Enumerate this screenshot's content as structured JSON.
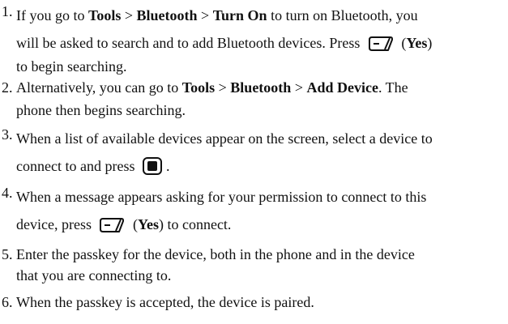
{
  "steps": [
    {
      "num": "1.",
      "l1_a": "If you go to ",
      "l1_b": "Tools",
      "l1_c": " > ",
      "l1_d": "Bluetooth",
      "l1_e": " > ",
      "l1_f": "Turn On",
      "l1_g": " to turn on Bluetooth, you",
      "l2_a": "will be asked to search and to add Bluetooth devices. Press ",
      "l2_b": " (",
      "l2_c": "Yes",
      "l2_d": ")",
      "l3": "to begin searching."
    },
    {
      "num": "2.",
      "l1_a": "Alternatively, you can go to ",
      "l1_b": "Tools",
      "l1_c": " > ",
      "l1_d": "Bluetooth",
      "l1_e": " > ",
      "l1_f": "Add Device",
      "l1_g": ". The",
      "l2": "phone then begins searching."
    },
    {
      "num": "3.",
      "l1": "When a list of available devices appear on the screen, select a device to",
      "l2_a": "connect to and press ",
      "l2_b": "."
    },
    {
      "num": "4.",
      "l1": "When a message appears asking for your permission to connect to this",
      "l2_a": "device, press ",
      "l2_b": " (",
      "l2_c": "Yes",
      "l2_d": ") to connect."
    },
    {
      "num": "5.",
      "l1": "Enter the passkey for the device, both in the phone and in the device",
      "l2": "that you are connecting to."
    },
    {
      "num": "6.",
      "l1": "When the passkey is accepted, the device is paired."
    }
  ],
  "icons": {
    "soft_key": "left-soft-key-icon",
    "center_key": "center-select-key-icon"
  }
}
